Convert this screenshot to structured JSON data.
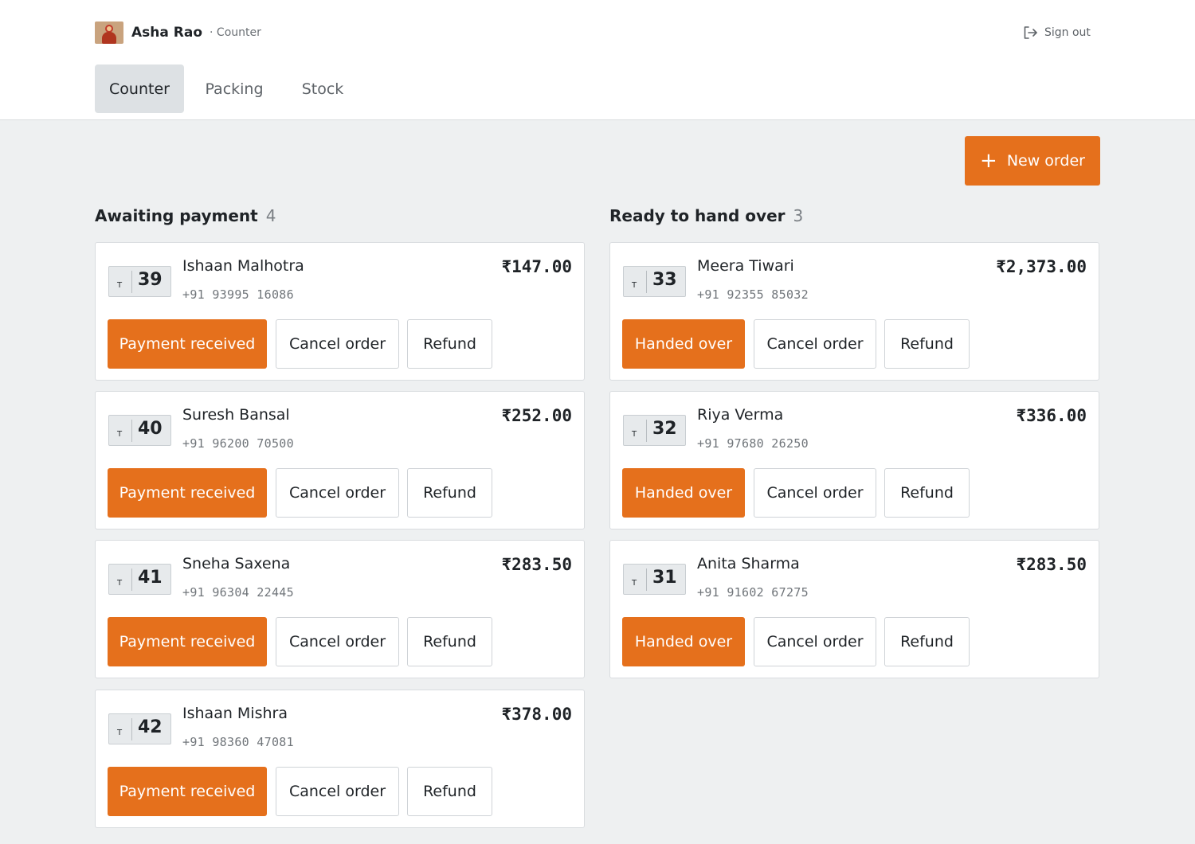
{
  "header": {
    "user_name": "Asha Rao",
    "user_role": "· Counter",
    "sign_out_label": "Sign out"
  },
  "tabs": [
    {
      "label": "Counter",
      "active": true
    },
    {
      "label": "Packing",
      "active": false
    },
    {
      "label": "Stock",
      "active": false
    }
  ],
  "new_order_label": "New order",
  "columns": {
    "awaiting": {
      "title": "Awaiting payment",
      "count": "4",
      "primary_action": "Payment received",
      "cancel_label": "Cancel order",
      "refund_label": "Refund",
      "orders": [
        {
          "tag_prefix": "T",
          "token": "39",
          "name": "Ishaan Malhotra",
          "phone": "+91 93995 16086",
          "amount": "₹147.00"
        },
        {
          "tag_prefix": "T",
          "token": "40",
          "name": "Suresh Bansal",
          "phone": "+91 96200 70500",
          "amount": "₹252.00"
        },
        {
          "tag_prefix": "T",
          "token": "41",
          "name": "Sneha Saxena",
          "phone": "+91 96304 22445",
          "amount": "₹283.50"
        },
        {
          "tag_prefix": "T",
          "token": "42",
          "name": "Ishaan Mishra",
          "phone": "+91 98360 47081",
          "amount": "₹378.00"
        }
      ]
    },
    "ready": {
      "title": "Ready to hand over",
      "count": "3",
      "primary_action": "Handed over",
      "cancel_label": "Cancel order",
      "refund_label": "Refund",
      "orders": [
        {
          "tag_prefix": "T",
          "token": "33",
          "name": "Meera Tiwari",
          "phone": "+91 92355 85032",
          "amount": "₹2,373.00"
        },
        {
          "tag_prefix": "T",
          "token": "32",
          "name": "Riya Verma",
          "phone": "+91 97680 26250",
          "amount": "₹336.00"
        },
        {
          "tag_prefix": "T",
          "token": "31",
          "name": "Anita Sharma",
          "phone": "+91 91602 67275",
          "amount": "₹283.50"
        }
      ]
    }
  },
  "colors": {
    "accent": "#e5701c",
    "background": "#eef0f1",
    "card": "#ffffff"
  },
  "icons": {
    "sign_out": "sign-out-icon",
    "new_order": "plus-icon",
    "avatar": "avatar-image"
  }
}
